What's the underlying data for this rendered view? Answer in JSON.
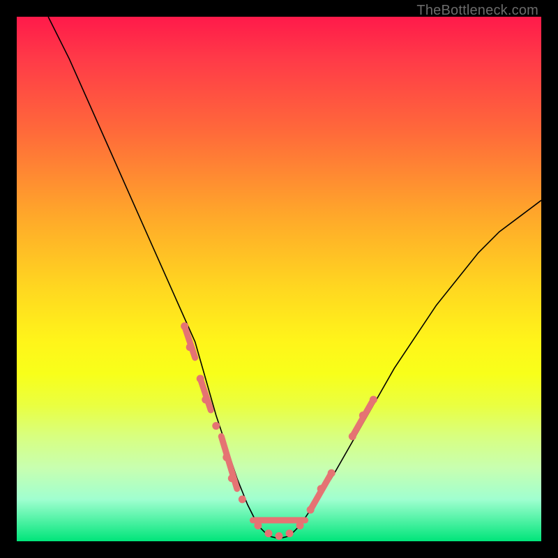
{
  "watermark": "TheBottleneck.com",
  "colors": {
    "curve": "#000000",
    "marker": "#e57373",
    "frame_bg_top": "#ff1a4a",
    "frame_bg_bottom": "#00e57a",
    "page_bg": "#000000",
    "watermark_text": "#6b6b6b"
  },
  "chart_data": {
    "type": "line",
    "title": "",
    "xlabel": "",
    "ylabel": "",
    "xlim": [
      0,
      100
    ],
    "ylim": [
      0,
      100
    ],
    "grid": false,
    "series": [
      {
        "name": "bottleneck-curve",
        "x": [
          6,
          10,
          14,
          18,
          22,
          26,
          30,
          34,
          38,
          40,
          42,
          44,
          46,
          48,
          50,
          52,
          54,
          56,
          60,
          64,
          68,
          72,
          76,
          80,
          84,
          88,
          92,
          96,
          100
        ],
        "y": [
          100,
          92,
          83,
          74,
          65,
          56,
          47,
          38,
          24,
          18,
          12,
          7,
          3,
          1,
          0.5,
          1,
          3,
          6,
          12,
          19,
          26,
          33,
          39,
          45,
          50,
          55,
          59,
          62,
          65
        ]
      }
    ],
    "markers": [
      {
        "name": "left-cluster-top",
        "x": 32,
        "y": 41
      },
      {
        "name": "left-cluster-a",
        "x": 33,
        "y": 37
      },
      {
        "name": "left-cluster-b",
        "x": 35,
        "y": 31
      },
      {
        "name": "left-cluster-c",
        "x": 36,
        "y": 27
      },
      {
        "name": "left-cluster-d",
        "x": 38,
        "y": 22
      },
      {
        "name": "left-cluster-e",
        "x": 40,
        "y": 16
      },
      {
        "name": "left-cluster-f",
        "x": 41,
        "y": 12
      },
      {
        "name": "left-cluster-g",
        "x": 43,
        "y": 8
      },
      {
        "name": "valley-a",
        "x": 46,
        "y": 3
      },
      {
        "name": "valley-b",
        "x": 48,
        "y": 1.5
      },
      {
        "name": "valley-c",
        "x": 50,
        "y": 1
      },
      {
        "name": "valley-d",
        "x": 52,
        "y": 1.5
      },
      {
        "name": "valley-e",
        "x": 54,
        "y": 3
      },
      {
        "name": "right-cluster-a",
        "x": 56,
        "y": 6
      },
      {
        "name": "right-cluster-b",
        "x": 58,
        "y": 10
      },
      {
        "name": "right-cluster-c",
        "x": 60,
        "y": 13
      },
      {
        "name": "right-cluster-top-a",
        "x": 64,
        "y": 20
      },
      {
        "name": "right-cluster-top-b",
        "x": 66,
        "y": 24
      },
      {
        "name": "right-cluster-top-c",
        "x": 68,
        "y": 27
      }
    ],
    "marker_segments": [
      {
        "name": "left-seg-1",
        "x1": 32,
        "y1": 41,
        "x2": 34,
        "y2": 35
      },
      {
        "name": "left-seg-2",
        "x1": 35,
        "y1": 31,
        "x2": 37,
        "y2": 25
      },
      {
        "name": "left-seg-3",
        "x1": 39,
        "y1": 20,
        "x2": 42,
        "y2": 10
      },
      {
        "name": "valley-seg",
        "x1": 45,
        "y1": 4,
        "x2": 55,
        "y2": 4
      },
      {
        "name": "right-seg-1",
        "x1": 56,
        "y1": 6,
        "x2": 60,
        "y2": 13
      },
      {
        "name": "right-seg-2",
        "x1": 64,
        "y1": 20,
        "x2": 68,
        "y2": 27
      }
    ]
  }
}
